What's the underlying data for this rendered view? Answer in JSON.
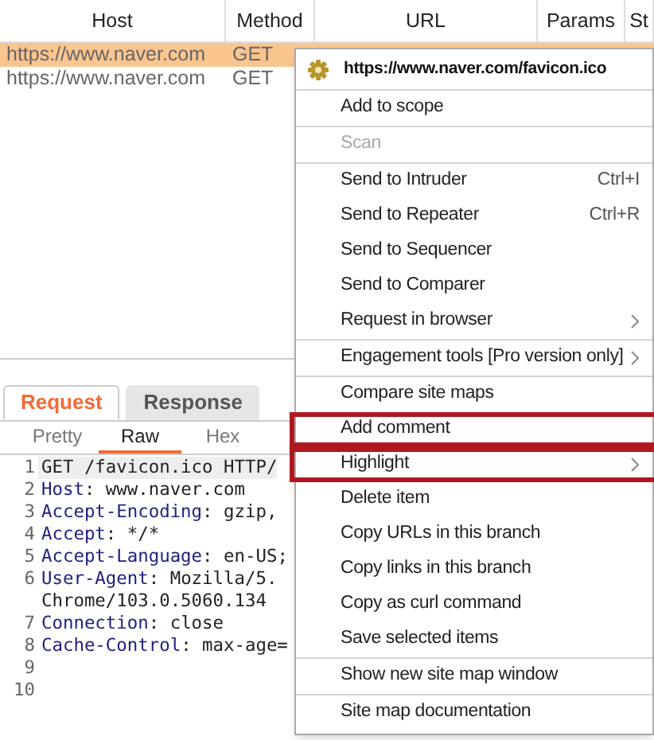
{
  "table": {
    "columns": [
      "Host",
      "Method",
      "URL",
      "Params",
      "St"
    ],
    "rows": [
      {
        "host": "https://www.naver.com",
        "method": "GET",
        "selected": true
      },
      {
        "host": "https://www.naver.com",
        "method": "GET",
        "selected": false
      }
    ]
  },
  "message_tabs": [
    {
      "label": "Request",
      "selected": true
    },
    {
      "label": "Response",
      "selected": false
    }
  ],
  "view_tabs": [
    {
      "label": "Pretty",
      "selected": false
    },
    {
      "label": "Raw",
      "selected": true
    },
    {
      "label": "Hex",
      "selected": false
    }
  ],
  "code_lines": [
    {
      "number": "1",
      "value": "GET /favicon.ico HTTP/"
    },
    {
      "number": "2",
      "key": "Host",
      "value": ": www.naver.com"
    },
    {
      "number": "3",
      "key": "Accept-Encoding",
      "value": ": gzip,"
    },
    {
      "number": "4",
      "key": "Accept",
      "value": ": */*"
    },
    {
      "number": "5",
      "key": "Accept-Language",
      "value": ": en-US;"
    },
    {
      "number": "6",
      "key": "User-Agent",
      "value": ": Mozilla/5."
    },
    {
      "value": "Chrome/103.0.5060.134"
    },
    {
      "number": "7",
      "key": "Connection",
      "value": ": close"
    },
    {
      "number": "8",
      "key": "Cache-Control",
      "value": ": max-age="
    },
    {
      "number": "9"
    },
    {
      "number": "10"
    }
  ],
  "context_menu": {
    "title": "https://www.naver.com/favicon.ico",
    "groups": [
      [
        {
          "label": "Add to scope",
          "disabled": false,
          "outlined": false
        }
      ],
      [
        {
          "label": "Scan",
          "disabled": true,
          "outlined": false
        }
      ],
      [
        {
          "label": "Send to Intruder",
          "shortcut": "Ctrl+I",
          "disabled": false,
          "outlined": false
        },
        {
          "label": "Send to Repeater",
          "shortcut": "Ctrl+R",
          "disabled": false,
          "outlined": false
        },
        {
          "label": "Send to Sequencer",
          "disabled": false,
          "outlined": false
        },
        {
          "label": "Send to Comparer",
          "disabled": false,
          "outlined": false
        },
        {
          "label": "Request in browser",
          "submenu": true,
          "disabled": false,
          "outlined": false
        }
      ],
      [
        {
          "label": "Engagement tools [Pro version only]",
          "submenu": true,
          "disabled": false,
          "outlined": false
        }
      ],
      [
        {
          "label": "Compare site maps",
          "disabled": false,
          "outlined": false
        },
        {
          "label": "Add comment",
          "disabled": false,
          "outlined": true
        },
        {
          "label": "Highlight",
          "submenu": true,
          "disabled": false,
          "outlined": true
        },
        {
          "label": "Delete item",
          "disabled": false,
          "outlined": false
        },
        {
          "label": "Copy URLs in this branch",
          "disabled": false,
          "outlined": false
        },
        {
          "label": "Copy links in this branch",
          "disabled": false,
          "outlined": false
        },
        {
          "label": "Copy as curl command",
          "disabled": false,
          "outlined": false
        },
        {
          "label": "Save selected items",
          "disabled": false,
          "outlined": false
        }
      ],
      [
        {
          "label": "Show new site map window",
          "disabled": false,
          "outlined": false
        }
      ],
      [
        {
          "label": "Site map documentation",
          "disabled": false,
          "outlined": false
        }
      ]
    ]
  }
}
